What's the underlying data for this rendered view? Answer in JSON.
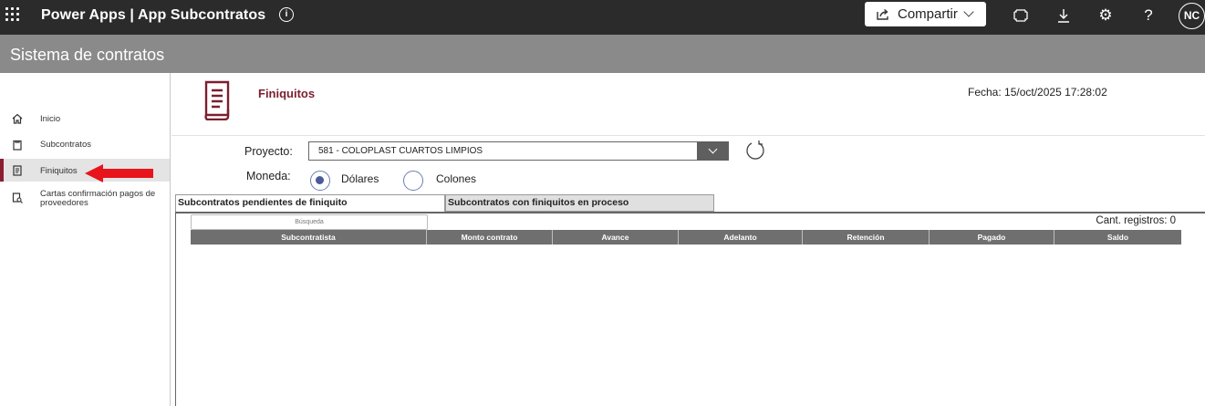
{
  "topbar": {
    "title": "Power Apps | App Subcontratos",
    "share_label": "Compartir",
    "icons": [
      "waffle-icon",
      "info-icon",
      "share-icon",
      "fit-screen-icon",
      "download-icon",
      "settings-icon",
      "help-icon"
    ],
    "avatar_initials": "NC"
  },
  "header": {
    "title": "Sistema de contratos"
  },
  "sidebar": {
    "items": [
      {
        "label": "Inicio",
        "icon": "home-icon"
      },
      {
        "label": "Subcontratos",
        "icon": "clipboard-icon"
      },
      {
        "label": "Finiquitos",
        "icon": "document-icon",
        "active": true
      },
      {
        "label_line1": "Cartas confirmación pagos de",
        "label_line2": "proveedores",
        "icon": "document-search-icon"
      }
    ]
  },
  "page": {
    "title": "Finiquitos",
    "date": "Fecha: 15/oct/2025 17:28:02",
    "accent": "#7b1f2e"
  },
  "form": {
    "project_label": "Proyecto:",
    "project_value": "581 - COLOPLAST CUARTOS LIMPIOS",
    "currency_label": "Moneda:",
    "currency_options": [
      {
        "label": "Dólares",
        "selected": true
      },
      {
        "label": "Colones",
        "selected": false
      }
    ]
  },
  "tabs": [
    {
      "label": "Subcontratos pendientes de finiquito",
      "active": true
    },
    {
      "label": "Subcontratos con finiquitos en proceso",
      "active": false
    }
  ],
  "table": {
    "search_placeholder": "Búsqueda",
    "count_label": "Cant. registros: 0",
    "columns": [
      "Subcontratista",
      "Monto contrato",
      "Avance",
      "Adelanto",
      "Retención",
      "Pagado",
      "Saldo"
    ],
    "rows": []
  },
  "colors": {
    "topbar": "#2b2b2b",
    "header": "#8a8a8a",
    "arrow": "#e8141b",
    "radio": "#4a5a9a"
  }
}
